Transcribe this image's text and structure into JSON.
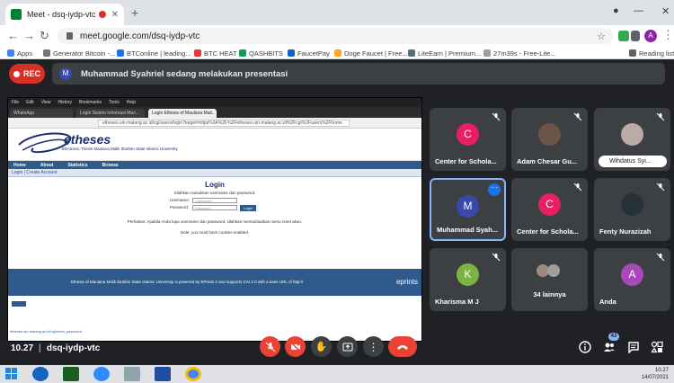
{
  "browser": {
    "tab_title": "Meet - dsq-iydp-vtc",
    "new_tab_symbol": "+",
    "url": "meet.google.com/dsq-iydp-vtc",
    "profile_initial": "A",
    "bookmarks": [
      {
        "label": "Apps",
        "color": "#4285f4"
      },
      {
        "label": "Generator Bitcoin -...",
        "color": "#757575"
      },
      {
        "label": "BTConline | leading...",
        "color": "#1a73e8"
      },
      {
        "label": "BTC HEAT",
        "color": "#e53935"
      },
      {
        "label": "QASHBITS",
        "color": "#0f9d58"
      },
      {
        "label": "FaucetPay",
        "color": "#1565c0"
      },
      {
        "label": "Doge Faucet | Free...",
        "color": "#f9a825"
      },
      {
        "label": "LiteEarn | Premium...",
        "color": "#546e7a"
      },
      {
        "label": "27m39s - Free-Lite...",
        "color": "#9e9e9e"
      }
    ],
    "reading_list": "Reading list"
  },
  "meet": {
    "rec_label": "REC",
    "banner_initial": "M",
    "banner_text": "Muhammad Syahriel sedang melakukan presentasi",
    "time": "10.27",
    "meeting_code": "dsq-iydp-vtc",
    "people_count": "43"
  },
  "presentation": {
    "menu": [
      "File",
      "Edit",
      "View",
      "History",
      "Bookmarks",
      "Tools",
      "Help"
    ],
    "tabs": [
      "WhatsApp",
      "Login Sistem Informasi Man...",
      "Login Ethesis of Maulana Mali..."
    ],
    "url": "etheses.uin-malang.ac.id/cgi/users/login?target=https%3A%2F%2Fetheses.uin-malang.ac.id%2Fcgi%2Fusers%2Fhome",
    "logo_text": "etheses",
    "logo_sub": "Electronic Thesis Maulana Malik Ibrahim State Islamic University",
    "nav": [
      "Home",
      "About",
      "Statistics",
      "Browse"
    ],
    "sub_nav": "Login | Create Account",
    "login_title": "Login",
    "login_hint": "Silahkan masukkan username dan password.",
    "username_label": "Username:",
    "username_placeholder": "Username",
    "password_label": "Password:",
    "password_placeholder": "Password",
    "login_button": "Login",
    "forgot_text": "Perhatian: Apabila Anda lupa username dan password, silahkan memanfaatkan menu reset akun.",
    "cookies_text": "Note: you must have cookies enabled.",
    "footer_text": "Ethesis of Maulana Malik Ibrahim State Islamic University is powered by EPrints 3 and supports OAI 2.0 with a base URL of http://",
    "footer_brand": "eprints",
    "status_url": "etheses.uin-malang.ac.id/cgi/reset_password"
  },
  "participants": [
    {
      "name": "Center for Schola...",
      "initial": "C",
      "color": "#e91e63"
    },
    {
      "name": "Adam Chesar Gu...",
      "initial": "",
      "color": "#6b5548"
    },
    {
      "name": "Wihdatus Syi...",
      "initial": "",
      "color": "#8d6e63"
    },
    {
      "name": "Muhammad Syah...",
      "initial": "M",
      "color": "#3949ab"
    },
    {
      "name": "Center for Schola...",
      "initial": "C",
      "color": "#e91e63"
    },
    {
      "name": "Fenty Nurazizah",
      "initial": "",
      "color": "#37474f"
    },
    {
      "name": "Kharisma M J",
      "initial": "K",
      "color": "#7cb342"
    },
    {
      "name": "34 lainnya",
      "initial": "",
      "color": "#9e9e9e"
    },
    {
      "name": "Anda",
      "initial": "A",
      "color": "#ab47bc"
    }
  ],
  "taskbar": {
    "time": "10.27",
    "date": "14/07/2021"
  }
}
